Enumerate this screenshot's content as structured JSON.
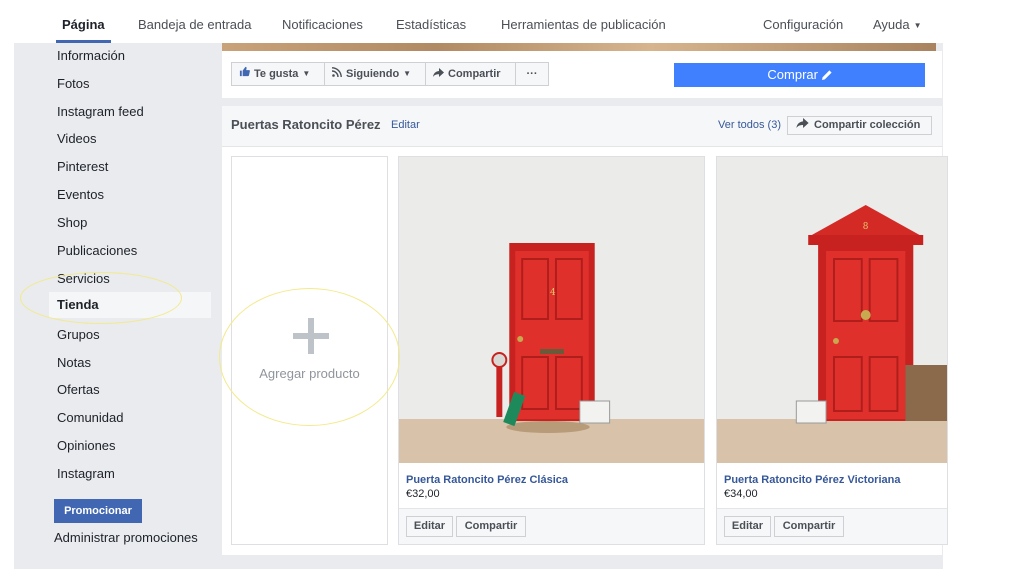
{
  "nav": {
    "tabs": [
      "Página",
      "Bandeja de entrada",
      "Notificaciones",
      "Estadísticas",
      "Herramientas de publicación"
    ],
    "settings": "Configuración",
    "help": "Ayuda"
  },
  "sidebar": {
    "items": [
      "Información",
      "Fotos",
      "Instagram feed",
      "Videos",
      "Pinterest",
      "Eventos",
      "Shop",
      "Publicaciones",
      "Servicios",
      "Tienda",
      "Grupos",
      "Notas",
      "Ofertas",
      "Comunidad",
      "Opiniones",
      "Instagram"
    ],
    "active": "Tienda",
    "promote": "Promocionar",
    "manage_promotions": "Administrar promociones"
  },
  "actions": {
    "like": "Te gusta",
    "following": "Siguiendo",
    "share": "Compartir",
    "more": "···",
    "buy": "Comprar"
  },
  "collection": {
    "title": "Puertas Ratoncito Pérez",
    "edit": "Editar",
    "view_all": "Ver todos (3)",
    "share_collection": "Compartir colección",
    "add_product": "Agregar producto",
    "products": [
      {
        "name": "Puerta Ratoncito Pérez Clásica",
        "price": "€32,00",
        "edit": "Editar",
        "share": "Compartir",
        "door_number": "4"
      },
      {
        "name": "Puerta Ratoncito Pérez Victoriana",
        "price": "€34,00",
        "edit": "Editar",
        "share": "Compartir",
        "door_number": "8"
      }
    ]
  },
  "colors": {
    "brand": "#4267b2",
    "buy": "#4080ff",
    "door": "#e0302c",
    "highlight": "#f2ea8c"
  }
}
